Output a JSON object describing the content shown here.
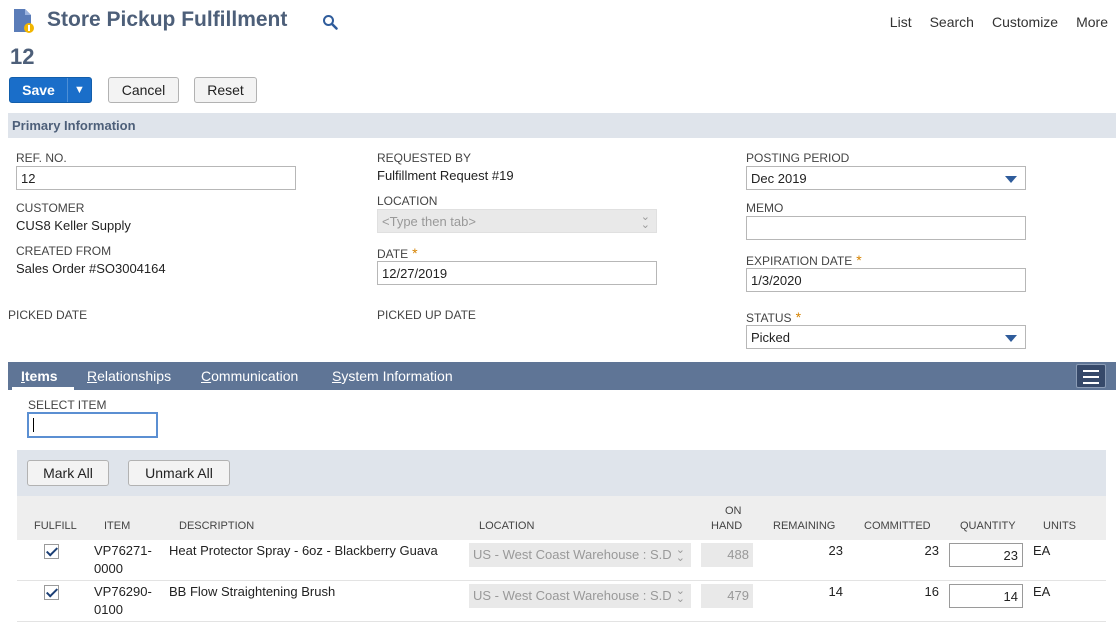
{
  "header": {
    "title": "Store Pickup Fulfillment",
    "record_id": "12",
    "nav": [
      "List",
      "Search",
      "Customize",
      "More"
    ]
  },
  "toolbar": {
    "save": "Save",
    "cancel": "Cancel",
    "reset": "Reset"
  },
  "section": {
    "primary": "Primary Information"
  },
  "fields": {
    "ref_no": {
      "label": "REF. NO.",
      "value": "12"
    },
    "customer": {
      "label": "CUSTOMER",
      "value": "CUS8 Keller Supply"
    },
    "created_from": {
      "label": "CREATED FROM",
      "value": "Sales Order #SO3004164"
    },
    "picked_date": {
      "label": "PICKED DATE"
    },
    "requested_by": {
      "label": "REQUESTED BY",
      "value": "Fulfillment Request #19"
    },
    "location": {
      "label": "LOCATION",
      "placeholder": "<Type then tab>"
    },
    "date": {
      "label": "DATE",
      "value": "12/27/2019"
    },
    "picked_up_date": {
      "label": "PICKED UP DATE"
    },
    "posting_period": {
      "label": "POSTING PERIOD",
      "value": "Dec 2019"
    },
    "memo": {
      "label": "MEMO",
      "value": ""
    },
    "expiration_date": {
      "label": "EXPIRATION DATE",
      "value": "1/3/2020"
    },
    "status": {
      "label": "STATUS",
      "value": "Picked"
    },
    "required_marker": "*"
  },
  "tabs": [
    {
      "first": "I",
      "rest": "tems"
    },
    {
      "first": "R",
      "rest": "elationships"
    },
    {
      "first": "C",
      "rest": "ommunication"
    },
    {
      "first": "S",
      "rest": "ystem Information"
    }
  ],
  "items": {
    "select_label": "SELECT ITEM",
    "mark_all": "Mark All",
    "unmark_all": "Unmark All",
    "columns": {
      "fulfill": "FULFILL",
      "item": "ITEM",
      "description": "DESCRIPTION",
      "location": "LOCATION",
      "on_hand_1": "ON",
      "on_hand_2": "HAND",
      "remaining": "REMAINING",
      "committed": "COMMITTED",
      "quantity": "QUANTITY",
      "units": "UNITS"
    },
    "rows": [
      {
        "item_1": "VP76271-",
        "item_2": "0000",
        "description": "Heat Protector Spray - 6oz - Blackberry Guava",
        "location": "US - West Coast Warehouse : S.D",
        "on_hand": "488",
        "remaining": "23",
        "committed": "23",
        "quantity": "23",
        "units": "EA",
        "fulfill": true
      },
      {
        "item_1": "VP76290-",
        "item_2": "0100",
        "description": "BB Flow Straightening Brush",
        "location": "US - West Coast Warehouse : S.D",
        "on_hand": "479",
        "remaining": "14",
        "committed": "16",
        "quantity": "14",
        "units": "EA",
        "fulfill": true
      }
    ]
  },
  "colors": {
    "primary_blue": "#1a6ec9",
    "tab_bar": "#5f7596",
    "section_bar": "#dfe4eb",
    "title": "#4d5f79",
    "link": "#255599"
  }
}
